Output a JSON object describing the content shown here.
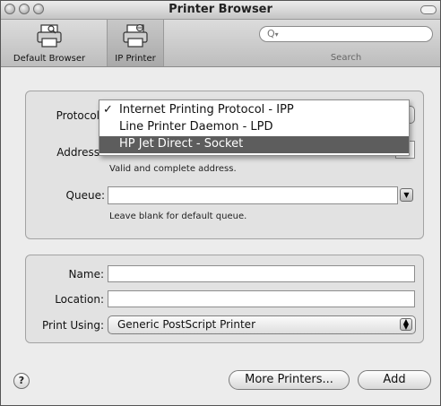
{
  "window": {
    "title": "Printer Browser"
  },
  "toolbar": {
    "default_browser_label": "Default Browser",
    "ip_printer_label": "IP Printer",
    "search_label": "Search",
    "search_placeholder": ""
  },
  "form": {
    "protocol_label": "Protocol",
    "address_label": "Address",
    "address_hint": "Valid and complete address.",
    "queue_label": "Queue:",
    "queue_hint": "Leave blank for default queue.",
    "name_label": "Name:",
    "location_label": "Location:",
    "print_using_label": "Print Using:",
    "print_using_value": "Generic PostScript Printer"
  },
  "protocol_menu": {
    "check_glyph": "✓",
    "items": [
      {
        "label": "Internet Printing Protocol - IPP",
        "checked": true,
        "highlighted": false
      },
      {
        "label": "Line Printer Daemon - LPD",
        "checked": false,
        "highlighted": false
      },
      {
        "label": "HP Jet Direct - Socket",
        "checked": false,
        "highlighted": true
      }
    ]
  },
  "buttons": {
    "help_label": "?",
    "more_printers_label": "More Printers...",
    "add_label": "Add"
  },
  "icons": {
    "close": "circle-button-icon",
    "minimize": "circle-button-icon",
    "zoom": "circle-button-icon",
    "default_browser": "printer-icon",
    "ip_printer": "network-printer-icon",
    "search": "magnifier-icon"
  },
  "colors": {
    "menu_highlight": "#5d5d5d",
    "window_bg": "#ececec"
  }
}
